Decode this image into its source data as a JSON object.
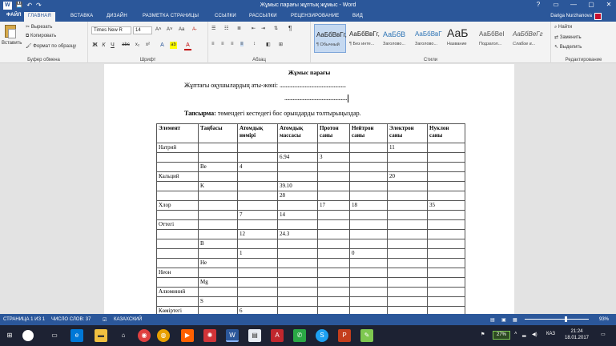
{
  "window": {
    "title": "Жұмыс парағы жұптық жұмыс - Word",
    "controls": [
      "?",
      "▭",
      "—",
      "▢",
      "✕"
    ]
  },
  "quick_access": [
    "W",
    "💾",
    "↶",
    "↷"
  ],
  "tabs": {
    "file": "ФАЙЛ",
    "items": [
      "ГЛАВНАЯ",
      "ВСТАВКА",
      "ДИЗАЙН",
      "РАЗМЕТКА СТРАНИЦЫ",
      "ССЫЛКИ",
      "РАССЫЛКИ",
      "РЕЦЕНЗИРОВАНИЕ",
      "ВИД"
    ],
    "active": "ГЛАВНАЯ",
    "user": "Dariga Nurzhanova"
  },
  "ribbon": {
    "clipboard": {
      "paste": "Вставить",
      "cut": "Вырезать",
      "copy": "Копировать",
      "format_painter": "Формат по образцу",
      "label": "Буфер обмена"
    },
    "font": {
      "name": "Times New R",
      "size": "14",
      "label": "Шрифт",
      "grow": "A˄",
      "shrink": "A˅",
      "case": "Aa",
      "clear": "A̶",
      "bold": "Ж",
      "italic": "К",
      "underline": "Ч",
      "strike": "abc",
      "sub": "x₂",
      "sup": "x²",
      "effects": "A",
      "highlight": "ab",
      "color": "A"
    },
    "paragraph": {
      "label": "Абзац",
      "pilcrow": "¶"
    },
    "styles": {
      "label": "Стили",
      "items": [
        {
          "sample": "АаБбВвГг,",
          "name": "¶ Обычный"
        },
        {
          "sample": "АаБбВвГг,",
          "name": "¶ Без инте..."
        },
        {
          "sample": "АаБбВ",
          "name": "Заголово..."
        },
        {
          "sample": "АаБбВвГ",
          "name": "Заголово..."
        },
        {
          "sample": "АаБ",
          "name": "Название"
        },
        {
          "sample": "АаБбВеІ",
          "name": "Подзагол..."
        },
        {
          "sample": "АаБбВеГг",
          "name": "Слабое в..."
        }
      ]
    },
    "editing": {
      "label": "Редактирование",
      "find": "Найти",
      "replace": "Заменить",
      "select": "Выделить"
    }
  },
  "document": {
    "heading": "Жұмыс парағы",
    "line1_label": "Жұптағы оқушылардың аты-жөні:",
    "line1_dots": ".......................................................",
    "line2_dots": "....................................................",
    "task_bold": "Тапсырма:",
    "task_text": " төмендегі кестедегі бос орындарды толтырыңыздар.",
    "table": {
      "headers": [
        "Элемент",
        "Таңбасы",
        "Атомдық нөмірі",
        "Атомдық массасы",
        "Протон саны",
        "Нейтрон саны",
        "Электрон саны",
        "Нуклон саны"
      ],
      "rows": [
        [
          "Натрий",
          "",
          "",
          "",
          "",
          "",
          "11",
          ""
        ],
        [
          "",
          "",
          "",
          "6.94",
          "3",
          "",
          "",
          ""
        ],
        [
          "",
          "Be",
          "4",
          "",
          "",
          "",
          "",
          ""
        ],
        [
          "Кальций",
          "",
          "",
          "",
          "",
          "",
          "20",
          ""
        ],
        [
          "",
          "K",
          "",
          "39.10",
          "",
          "",
          "",
          ""
        ],
        [
          "",
          "",
          "",
          "28",
          "",
          "",
          "",
          ""
        ],
        [
          "Хлор",
          "",
          "",
          "",
          "17",
          "18",
          "",
          "35"
        ],
        [
          "",
          "",
          "7",
          "14",
          "",
          "",
          "",
          ""
        ],
        [
          "Оттегі",
          "",
          "",
          "",
          "",
          "",
          "",
          ""
        ],
        [
          "",
          "",
          "12",
          "24.3",
          "",
          "",
          "",
          ""
        ],
        [
          "",
          "B",
          "",
          "",
          "",
          "",
          "",
          ""
        ],
        [
          "",
          "",
          "1",
          "",
          "",
          "0",
          "",
          ""
        ],
        [
          "",
          "He",
          "",
          "",
          "",
          "",
          "",
          ""
        ],
        [
          "Неон",
          "",
          "",
          "",
          "",
          "",
          "",
          ""
        ],
        [
          "",
          "Mg",
          "",
          "",
          "",
          "",
          "",
          ""
        ],
        [
          "Алюминий",
          "",
          "",
          "",
          "",
          "",
          "",
          ""
        ],
        [
          "",
          "S",
          "",
          "",
          "",
          "",
          "",
          ""
        ],
        [
          "Көміртегі",
          "",
          "6",
          "",
          "",
          "",
          "",
          ""
        ]
      ]
    }
  },
  "status": {
    "page": "СТРАНИЦА 1 ИЗ 1",
    "words": "ЧИСЛО СЛОВ: 37",
    "lang": "КАЗАХСКИЙ",
    "zoom": "93%"
  },
  "taskbar": {
    "battery": "27%",
    "lang": "КАЗ",
    "time": "21:24",
    "date": "18.01.2017"
  },
  "colors": {
    "accent": "#2b579a",
    "ribbon_bg": "#f3f3f3",
    "taskbar_bg": "#1d2233"
  }
}
